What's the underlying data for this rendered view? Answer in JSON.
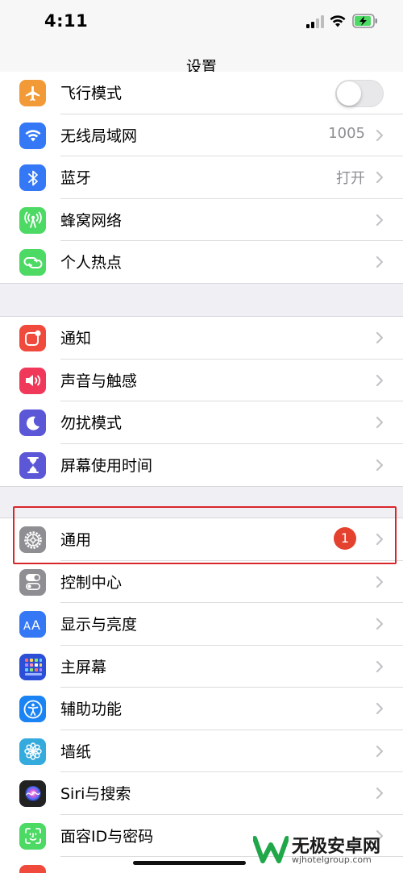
{
  "status_bar": {
    "time": "4:11"
  },
  "nav": {
    "title": "设置"
  },
  "group1": [
    {
      "label": "飞行模式",
      "value": "",
      "icon": "airplane-icon",
      "color": "#f19a37"
    },
    {
      "label": "无线局域网",
      "value": "1005",
      "icon": "wifi-icon",
      "color": "#3478f6"
    },
    {
      "label": "蓝牙",
      "value": "打开",
      "icon": "bluetooth-icon",
      "color": "#3478f6"
    },
    {
      "label": "蜂窝网络",
      "value": "",
      "icon": "cellular-icon",
      "color": "#4cd964"
    },
    {
      "label": "个人热点",
      "value": "",
      "icon": "hotspot-icon",
      "color": "#4cd964"
    }
  ],
  "group2": [
    {
      "label": "通知",
      "icon": "notifications-icon",
      "color": "#f04a3c"
    },
    {
      "label": "声音与触感",
      "icon": "sounds-icon",
      "color": "#f0395a"
    },
    {
      "label": "勿扰模式",
      "icon": "moon-icon",
      "color": "#5b57d6"
    },
    {
      "label": "屏幕使用时间",
      "icon": "hourglass-icon",
      "color": "#5b57d6"
    }
  ],
  "group3": [
    {
      "label": "通用",
      "badge": "1",
      "icon": "gear-icon",
      "color": "#8e8e93"
    },
    {
      "label": "控制中心",
      "icon": "toggles-icon",
      "color": "#8e8e93"
    },
    {
      "label": "显示与亮度",
      "icon": "text-size-icon",
      "color": "#3478f6"
    },
    {
      "label": "主屏幕",
      "icon": "home-grid-icon",
      "color": "#2c4fd8"
    },
    {
      "label": "辅助功能",
      "icon": "accessibility-icon",
      "color": "#1a84f4"
    },
    {
      "label": "墙纸",
      "icon": "flower-icon",
      "color": "#35aadc"
    },
    {
      "label": "Siri与搜索",
      "icon": "siri-icon",
      "color": "#222222"
    },
    {
      "label": "面容ID与密码",
      "icon": "face-id-icon",
      "color": "#4cd964"
    }
  ],
  "watermark": {
    "title": "无极安卓网",
    "url": "wjhotelgroup.com"
  }
}
